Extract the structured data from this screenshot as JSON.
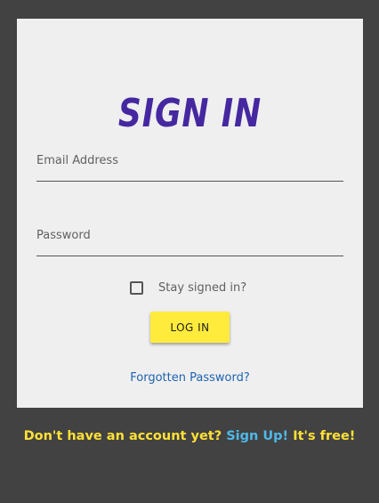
{
  "colors": {
    "page_background": "#424242",
    "card_background": "#efefef",
    "title": "#4527a0",
    "accent_button": "#ffeb3b",
    "link": "#1e63b0",
    "footer_text": "#ffe135",
    "footer_link": "#4fb8e8"
  },
  "card": {
    "title": "SIGN IN",
    "email": {
      "label": "Email Address",
      "value": ""
    },
    "password": {
      "label": "Password",
      "value": ""
    },
    "stay_signed_in": {
      "label": "Stay signed in?",
      "checked": false
    },
    "login_button": "LOG IN",
    "forgot_link": "Forgotten Password?"
  },
  "footer": {
    "prompt": "Don't have an account yet?",
    "signup_link": "Sign Up!",
    "suffix": "It's free!"
  }
}
